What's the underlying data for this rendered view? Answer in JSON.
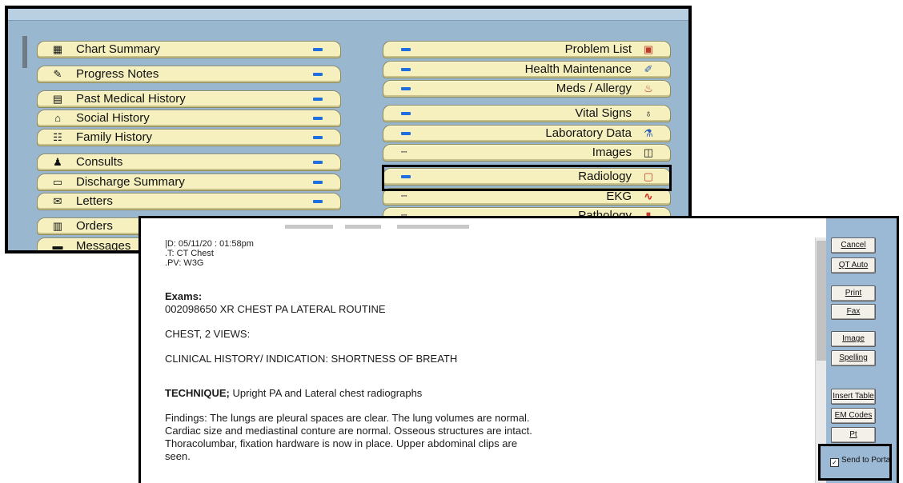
{
  "chart_menu": {
    "left_items": [
      {
        "label": "Chart Summary",
        "icon": "calculator-icon",
        "glyph": "▦"
      },
      {
        "label": "Progress Notes",
        "icon": "note-pencil-icon",
        "glyph": "✎"
      },
      {
        "label": "Past Medical History",
        "icon": "document-stack-icon",
        "glyph": "▤"
      },
      {
        "label": "Social History",
        "icon": "house-icon",
        "glyph": "⌂"
      },
      {
        "label": "Family History",
        "icon": "family-tree-icon",
        "glyph": "☷"
      },
      {
        "label": "Consults",
        "icon": "people-icon",
        "glyph": "♟"
      },
      {
        "label": "Discharge Summary",
        "icon": "hospital-bed-icon",
        "glyph": "▭"
      },
      {
        "label": "Letters",
        "icon": "envelope-icon",
        "glyph": "✉"
      },
      {
        "label": "Orders",
        "icon": "orders-form-icon",
        "glyph": "▥"
      },
      {
        "label": "Messages",
        "icon": "message-icon",
        "glyph": "▬"
      }
    ],
    "right_items": [
      {
        "label": "Problem List",
        "icon": "problem-list-icon",
        "glyph": "▣"
      },
      {
        "label": "Health Maintenance",
        "icon": "syringe-icon",
        "glyph": "✐"
      },
      {
        "label": "Meds / Allergy",
        "icon": "pill-bottle-icon",
        "glyph": "♨"
      },
      {
        "label": "Vital Signs",
        "icon": "stethoscope-icon",
        "glyph": "♁"
      },
      {
        "label": "Laboratory Data",
        "icon": "lab-flask-icon",
        "glyph": "⚗"
      },
      {
        "label": "Images",
        "icon": "camera-icon",
        "glyph": "◫"
      },
      {
        "label": "Radiology",
        "icon": "xray-icon",
        "glyph": "▢"
      },
      {
        "label": "EKG",
        "icon": "ekg-wave-icon",
        "glyph": "∿"
      },
      {
        "label": "Pathology",
        "icon": "microscope-icon",
        "glyph": "▮"
      }
    ]
  },
  "report": {
    "meta_date": "|D: 05/11/20 : 01:58pm",
    "meta_type": ".T: CT Chest",
    "meta_pv": ".PV: W3G",
    "exams_heading": "Exams:",
    "exam_line": "002098650 XR CHEST PA LATERAL ROUTINE",
    "views": "CHEST, 2 VIEWS:",
    "clinical_history": "CLINICAL HISTORY/ INDICATION: SHORTNESS OF BREATH",
    "technique_label": "TECHNIQUE;",
    "technique_text": " Upright PA and Lateral chest radiographs",
    "findings_1": "Findings: The lungs are pleural spaces are clear. The lung volumes are normal.",
    "findings_2": "Cardiac size and mediastinal conture are normal. Osseous structures are intact.",
    "findings_3": "Thoracolumbar, fixation hardware is now in place. Upper abdominal clips are",
    "findings_4": "seen."
  },
  "side_buttons": {
    "cancel": "Cancel",
    "qt_auto": "QT Auto",
    "print": "Print",
    "fax": "Fax",
    "image": "Image",
    "spelling": "Spelling",
    "insert_table": "Insert Table",
    "em_codes": "EM Codes",
    "pt_comment": "Pt Comment"
  },
  "send_to_portal": {
    "label": "Send to Porta",
    "checked": true
  }
}
